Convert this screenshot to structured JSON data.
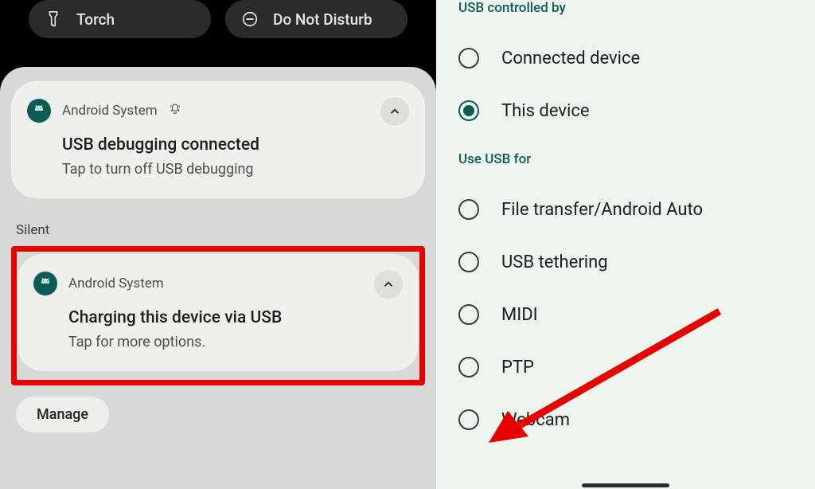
{
  "left": {
    "qs": {
      "torch": "Torch",
      "dnd": "Do Not Disturb"
    },
    "notif1": {
      "app": "Android System",
      "title": "USB debugging connected",
      "body": "Tap to turn off USB debugging"
    },
    "silent_label": "Silent",
    "notif2": {
      "app": "Android System",
      "title": "Charging this device via USB",
      "body": "Tap for more options."
    },
    "manage": "Manage"
  },
  "right": {
    "group1_title": "USB controlled by",
    "group1": {
      "opt1": "Connected device",
      "opt2": "This device"
    },
    "group2_title": "Use USB for",
    "group2": {
      "opt1": "File transfer/Android Auto",
      "opt2": "USB tethering",
      "opt3": "MIDI",
      "opt4": "PTP",
      "opt5": "Webcam"
    }
  }
}
